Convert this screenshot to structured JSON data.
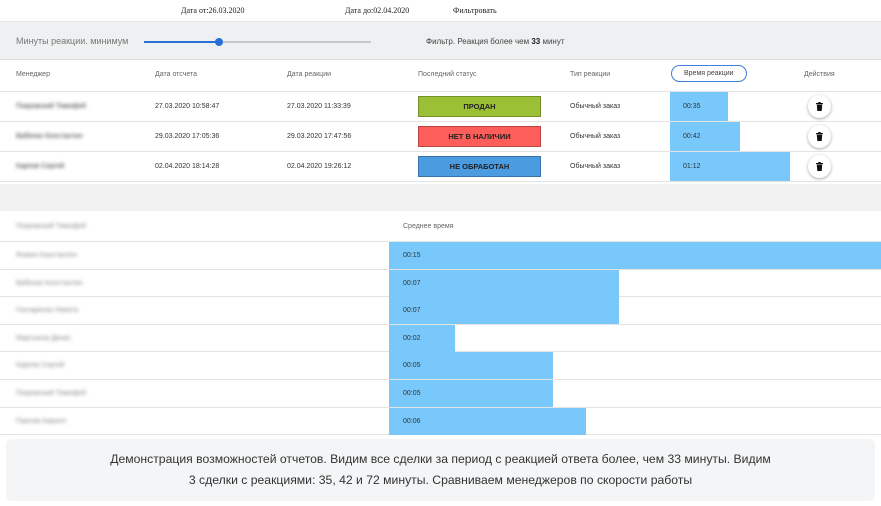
{
  "topbar": {
    "date_from": "Дата от:26.03.2020",
    "date_to": "Дата до:02.04.2020",
    "filter_label": "Фильтровать"
  },
  "filter": {
    "label": "Минуты реакции. минимум",
    "slider_value_fraction": 0.33,
    "info_prefix": "Фильтр. Реакция более чем",
    "info_value": "33",
    "info_suffix": "минут"
  },
  "deals_table": {
    "columns": [
      "Менеджер",
      "Дата отсчета",
      "Дата реакции",
      "Последний статус",
      "Тип реакции",
      "Время реакции",
      "Действия"
    ],
    "rows": [
      {
        "manager": "Покровский Тимофей",
        "start": "27.03.2020 10:58:47",
        "reaction": "27.03.2020 11:33:39",
        "status": "ПРОДАН",
        "status_color": "#9bbf35",
        "type": "Обычный заказ",
        "time": "00:35",
        "minutes": 35
      },
      {
        "manager": "Вабенко Константин",
        "start": "29.03.2020 17:05:36",
        "reaction": "29.03.2020 17:47:56",
        "status": "НЕТ В НАЛИЧИИ",
        "status_color": "#fd5e5a",
        "type": "Обычный заказ",
        "time": "00:42",
        "minutes": 42
      },
      {
        "manager": "Карпов Сергей",
        "start": "02.04.2020 18:14:28",
        "reaction": "02.04.2020 19:26:12",
        "status": "НЕ ОБРАБОТАН",
        "status_color": "#4a9be0",
        "type": "Обычный заказ",
        "time": "01:12",
        "minutes": 72
      }
    ],
    "delete_icon": "trash-icon"
  },
  "avg_chart": {
    "header_name": "Покровский Тимофей",
    "title": "Среднее время",
    "rows": [
      {
        "manager": "Фомин Константин",
        "time": "00:15",
        "minutes": 15
      },
      {
        "manager": "Вабенко Константин",
        "time": "00:07",
        "minutes": 7
      },
      {
        "manager": "Гончаренко Никита",
        "time": "00:07",
        "minutes": 7
      },
      {
        "manager": "Мартынов Денис",
        "time": "00:02",
        "minutes": 2
      },
      {
        "manager": "Карпов Сергей",
        "time": "00:05",
        "minutes": 5
      },
      {
        "manager": "Покровский Тимофей",
        "time": "00:05",
        "minutes": 5
      },
      {
        "manager": "Павлов Кирилл",
        "time": "00:06",
        "minutes": 6
      }
    ],
    "bar_color": "#79c8fb"
  },
  "caption": "Демонстрация возможностей отчетов. Видим все сделки за период с реакцией ответа более, чем 33 минуты. Видим 3 сделки с реакциями: 35, 42 и 72 минуты. Сравниваем менеджеров по скорости работы"
}
